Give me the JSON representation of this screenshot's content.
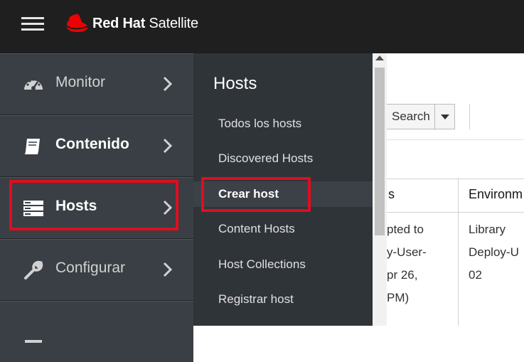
{
  "masthead": {
    "brand_bold": "Red Hat",
    "brand_rest": " Satellite",
    "brand_color": "#ee0000",
    "menu_icon": "hamburger-menu-icon"
  },
  "primary_nav": {
    "items": [
      {
        "label": "Monitor",
        "icon": "dashboard-gauge-icon"
      },
      {
        "label": "Contenido",
        "icon": "book-icon"
      },
      {
        "label": "Hosts",
        "icon": "server-stack-icon"
      },
      {
        "label": "Configurar",
        "icon": "wrench-icon"
      }
    ]
  },
  "secondary_nav": {
    "title": "Hosts",
    "items": [
      {
        "label": "Todos los hosts"
      },
      {
        "label": "Discovered Hosts"
      },
      {
        "label": "Crear host"
      },
      {
        "label": "Content Hosts"
      },
      {
        "label": "Host Collections"
      },
      {
        "label": "Registrar host"
      }
    ]
  },
  "background": {
    "search_label": "Search",
    "col1_header": "s",
    "col2_header": "Environm",
    "col1_text": "pted to\ny-User-\npr 26,\nPM)",
    "col2_text": "Library\nDeploy-U\n02"
  },
  "highlight_color": "#e00d20"
}
